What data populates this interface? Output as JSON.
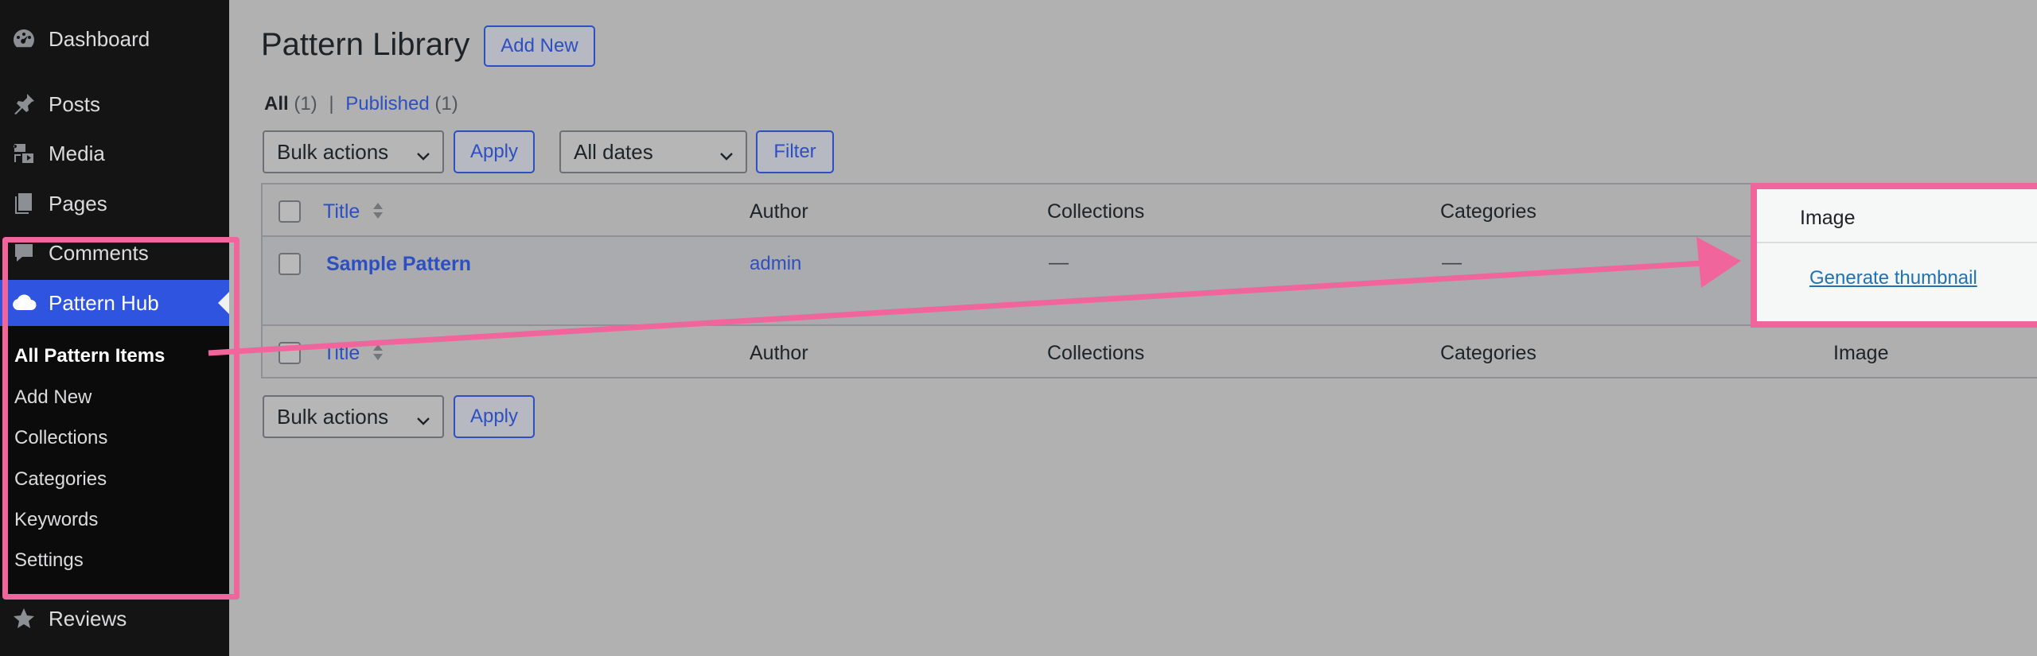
{
  "sidebar": {
    "items": [
      {
        "id": "dashboard",
        "label": "Dashboard",
        "icon": "dashboard-icon"
      },
      {
        "id": "posts",
        "label": "Posts",
        "icon": "pin-icon"
      },
      {
        "id": "media",
        "label": "Media",
        "icon": "media-icon"
      },
      {
        "id": "pages",
        "label": "Pages",
        "icon": "pages-icon"
      },
      {
        "id": "comments",
        "label": "Comments",
        "icon": "comment-icon"
      },
      {
        "id": "patternhub",
        "label": "Pattern Hub",
        "icon": "cloud-icon"
      },
      {
        "id": "reviews",
        "label": "Reviews",
        "icon": "star-icon"
      }
    ],
    "submenu": [
      "All Pattern Items",
      "Add New",
      "Collections",
      "Categories",
      "Keywords",
      "Settings"
    ]
  },
  "header": {
    "title": "Pattern Library",
    "add_new": "Add New"
  },
  "views": {
    "all_label": "All",
    "all_count": "(1)",
    "separator": "|",
    "published_label": "Published",
    "published_count": "(1)"
  },
  "toolbar": {
    "bulk_actions": "Bulk actions",
    "apply": "Apply",
    "dates": "All dates",
    "filter": "Filter"
  },
  "table": {
    "columns": [
      "Title",
      "Author",
      "Collections",
      "Categories",
      "Image"
    ],
    "rows": [
      {
        "title": "Sample Pattern",
        "author": "admin",
        "collections": "—",
        "categories": "—",
        "image_action": "Generate thumbnail"
      }
    ]
  },
  "annotation": {
    "highlight_color": "#f0659b"
  }
}
